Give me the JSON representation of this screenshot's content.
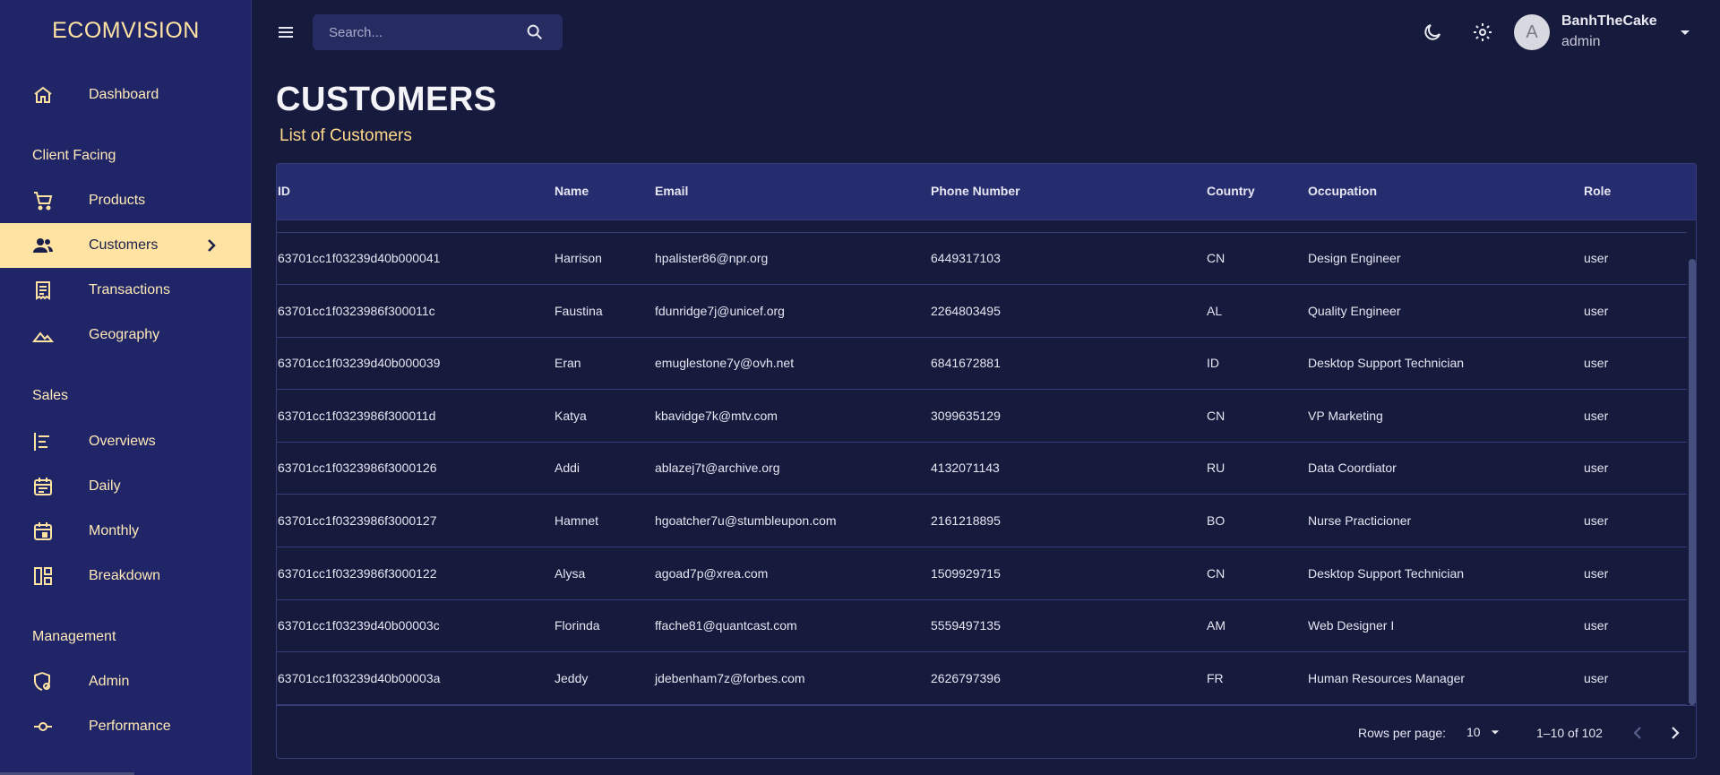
{
  "app": {
    "brand": "ECOMVISION"
  },
  "sidebar": {
    "dashboard": {
      "label": "Dashboard"
    },
    "sections": {
      "client_facing": "Client Facing",
      "sales": "Sales",
      "management": "Management"
    },
    "items": {
      "products": "Products",
      "customers": "Customers",
      "transactions": "Transactions",
      "geography": "Geography",
      "overviews": "Overviews",
      "daily": "Daily",
      "monthly": "Monthly",
      "breakdown": "Breakdown",
      "admin": "Admin",
      "performance": "Performance"
    }
  },
  "topbar": {
    "search_placeholder": "Search...",
    "user": {
      "avatar_letter": "A",
      "name": "BanhTheCake",
      "role": "admin"
    }
  },
  "page": {
    "title": "CUSTOMERS",
    "subtitle": "List of Customers"
  },
  "table": {
    "columns": [
      "ID",
      "Name",
      "Email",
      "Phone Number",
      "Country",
      "Occupation",
      "Role"
    ],
    "rows": [
      [
        "63701cc1f03239d40b000041",
        "Harrison",
        "hpalister86@npr.org",
        "6449317103",
        "CN",
        "Design Engineer",
        "user"
      ],
      [
        "63701cc1f0323986f300011c",
        "Faustina",
        "fdunridge7j@unicef.org",
        "2264803495",
        "AL",
        "Quality Engineer",
        "user"
      ],
      [
        "63701cc1f03239d40b000039",
        "Eran",
        "emuglestone7y@ovh.net",
        "6841672881",
        "ID",
        "Desktop Support Technician",
        "user"
      ],
      [
        "63701cc1f0323986f300011d",
        "Katya",
        "kbavidge7k@mtv.com",
        "3099635129",
        "CN",
        "VP Marketing",
        "user"
      ],
      [
        "63701cc1f0323986f3000126",
        "Addi",
        "ablazej7t@archive.org",
        "4132071143",
        "RU",
        "Data Coordiator",
        "user"
      ],
      [
        "63701cc1f0323986f3000127",
        "Hamnet",
        "hgoatcher7u@stumbleupon.com",
        "2161218895",
        "BO",
        "Nurse Practicioner",
        "user"
      ],
      [
        "63701cc1f0323986f3000122",
        "Alysa",
        "agoad7p@xrea.com",
        "1509929715",
        "CN",
        "Desktop Support Technician",
        "user"
      ],
      [
        "63701cc1f03239d40b00003c",
        "Florinda",
        "ffache81@quantcast.com",
        "5559497135",
        "AM",
        "Web Designer I",
        "user"
      ],
      [
        "63701cc1f03239d40b00003a",
        "Jeddy",
        "jdebenham7z@forbes.com",
        "2626797396",
        "FR",
        "Human Resources Manager",
        "user"
      ]
    ],
    "footer": {
      "rows_per_page_label": "Rows per page:",
      "rows_per_page": "10",
      "range": "1–10 of 102"
    }
  },
  "colors": {
    "sidebar_bg": "#1f2566",
    "main_bg": "#161a3d",
    "accent": "#ffe3a3",
    "header_bg": "#262d6e"
  }
}
